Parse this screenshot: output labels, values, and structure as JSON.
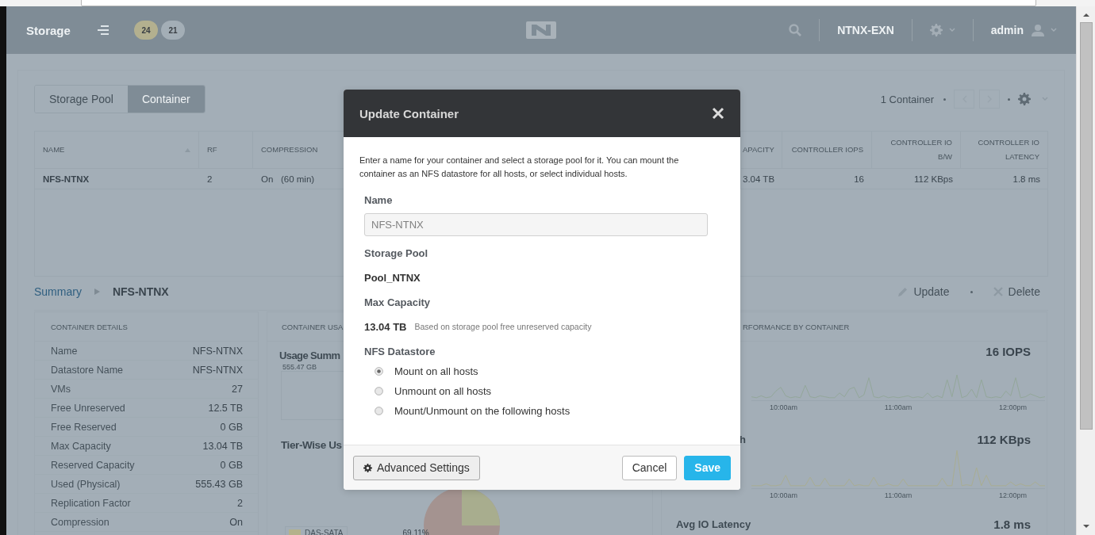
{
  "header": {
    "title": "Storage",
    "alerts": [
      {
        "count": "24",
        "color": "#b3b08f"
      },
      {
        "count": "21",
        "color": "#a3aeb6"
      }
    ],
    "cluster": "NTNX-EXN",
    "user": "admin"
  },
  "view_tabs": [
    {
      "label": "Storage Pool",
      "selected": false
    },
    {
      "label": "Container",
      "selected": true
    }
  ],
  "table": {
    "count_label": "1 Container",
    "columns": [
      {
        "label": "NAME",
        "sorted": true
      },
      {
        "label": "RF",
        "sorted": false
      },
      {
        "label": "COMPRESSION",
        "sorted": false
      },
      {
        "label": "APACITY",
        "sorted": false
      },
      {
        "label": "CONTROLLER IOPS",
        "sorted": false
      },
      {
        "label": "CONTROLLER IO B/W",
        "sorted": false
      },
      {
        "label": "CONTROLLER IO LATENCY",
        "sorted": false
      }
    ],
    "rows": [
      {
        "cells": [
          "NFS-NTNX",
          "2",
          "On   (60 min)",
          "3.04 TB",
          "16",
          "112 KBps",
          "1.8 ms"
        ]
      }
    ]
  },
  "summary": {
    "link": "Summary",
    "current": "NFS-NTNX",
    "actions": [
      {
        "label": "Update",
        "kind": "edit"
      },
      {
        "label": "Delete",
        "kind": "delete"
      }
    ]
  },
  "details": {
    "title": "CONTAINER DETAILS",
    "rows": [
      {
        "label": "Name",
        "value": "NFS-NTNX"
      },
      {
        "label": "Datastore Name",
        "value": "NFS-NTNX"
      },
      {
        "label": "VMs",
        "value": "27"
      },
      {
        "label": "Free Unreserved",
        "value": "12.5 TB"
      },
      {
        "label": "Free Reserved",
        "value": "0 GB"
      },
      {
        "label": "Max Capacity",
        "value": "13.04 TB"
      },
      {
        "label": "Reserved Capacity",
        "value": "0 GB"
      },
      {
        "label": "Used (Physical)",
        "value": "555.43 GB"
      },
      {
        "label": "Replication Factor",
        "value": "2"
      },
      {
        "label": "Compression",
        "value": "On"
      }
    ]
  },
  "usage": {
    "title": "CONTAINER USA",
    "usage_heading": "Usage Summ",
    "usage_value": "555.47 GB",
    "tier_heading": "Tier-Wise Us",
    "legend": [
      {
        "label": "DAS-SATA",
        "color": "#b4b28c",
        "percent": "69.11%"
      }
    ]
  },
  "performance": {
    "title": "RFORMANCE BY CONTAINER",
    "metrics": [
      {
        "value": "16 IOPS",
        "color": "#93a79a",
        "ticks": [
          "10:00am",
          "11:00am",
          "12:00pm"
        ]
      },
      {
        "label": "h",
        "value": "112 KBps",
        "color": "#a9ad92",
        "ticks": [
          "10:00am",
          "11:00am",
          "12:00pm"
        ]
      },
      {
        "label": "Avg IO Latency",
        "value": "1.8 ms"
      }
    ]
  },
  "modal": {
    "title": "Update Container",
    "description": "Enter a name for your container and select a storage pool for it. You can mount the container as an NFS datastore for all hosts, or select individual hosts.",
    "fields": [
      {
        "kind": "input",
        "label": "Name",
        "value": "NFS-NTNX",
        "disabled": true
      },
      {
        "kind": "text",
        "label": "Storage Pool",
        "value": "Pool_NTNX"
      },
      {
        "kind": "capacity",
        "label": "Max Capacity",
        "value": "13.04 TB",
        "note": "Based on storage pool free unreserved capacity"
      },
      {
        "kind": "radio",
        "label": "NFS Datastore",
        "options": [
          {
            "label": "Mount on all hosts",
            "selected": true
          },
          {
            "label": "Unmount on all hosts",
            "selected": false
          },
          {
            "label": "Mount/Unmount on the following hosts",
            "selected": false
          }
        ]
      }
    ],
    "buttons": [
      {
        "label": "Advanced Settings",
        "kind": "advanced"
      },
      {
        "label": "Cancel",
        "kind": "secondary"
      },
      {
        "label": "Save",
        "kind": "primary"
      }
    ]
  }
}
